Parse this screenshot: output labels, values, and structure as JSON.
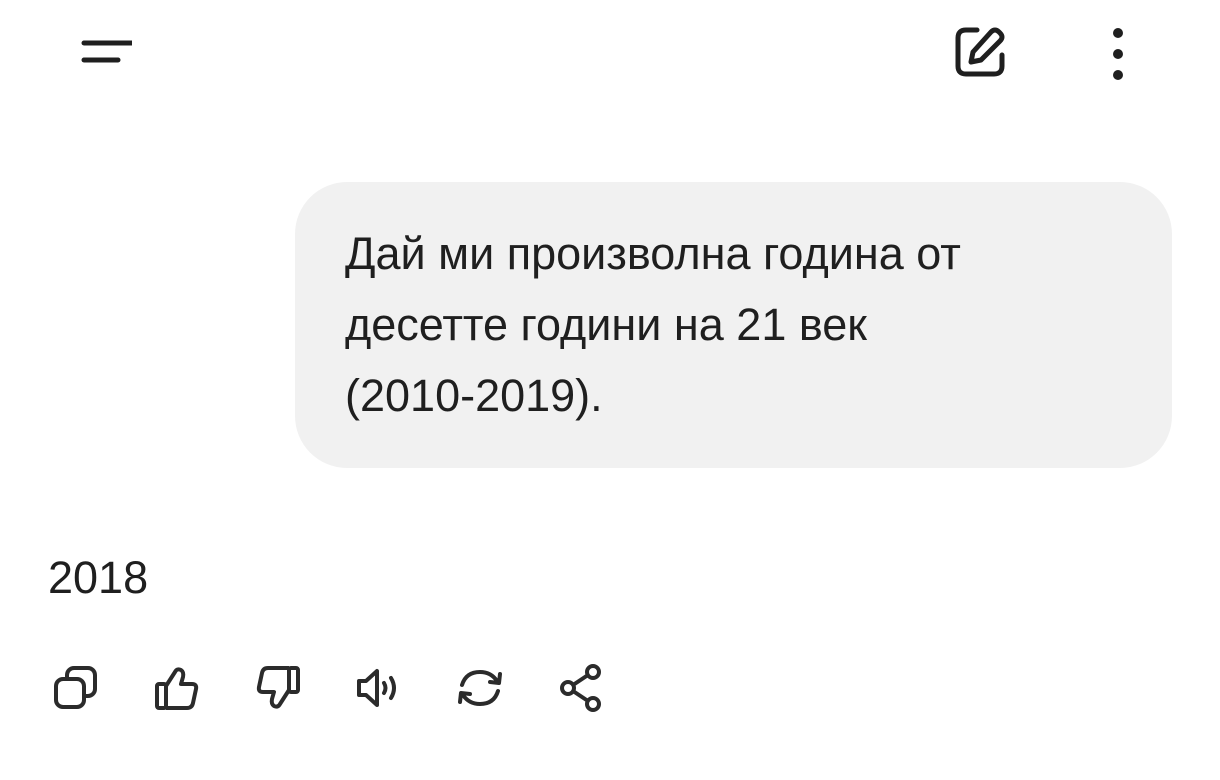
{
  "header": {
    "menu_icon": "menu-icon",
    "new_chat_icon": "edit-icon",
    "more_icon": "more-vertical-icon"
  },
  "conversation": {
    "user_message": "Дай ми произволна година от\nдесетте години на 21 век\n(2010-2019).",
    "assistant_response": "2018"
  },
  "response_actions": [
    {
      "name": "copy",
      "icon": "copy-icon"
    },
    {
      "name": "like",
      "icon": "thumbs-up-icon"
    },
    {
      "name": "dislike",
      "icon": "thumbs-down-icon"
    },
    {
      "name": "read-aloud",
      "icon": "speaker-icon"
    },
    {
      "name": "regenerate",
      "icon": "refresh-icon"
    },
    {
      "name": "share",
      "icon": "share-icon"
    }
  ],
  "colors": {
    "background": "#ffffff",
    "bubble": "#f1f1f1",
    "text": "#1f1f1f",
    "icon": "#2b2b2b"
  }
}
